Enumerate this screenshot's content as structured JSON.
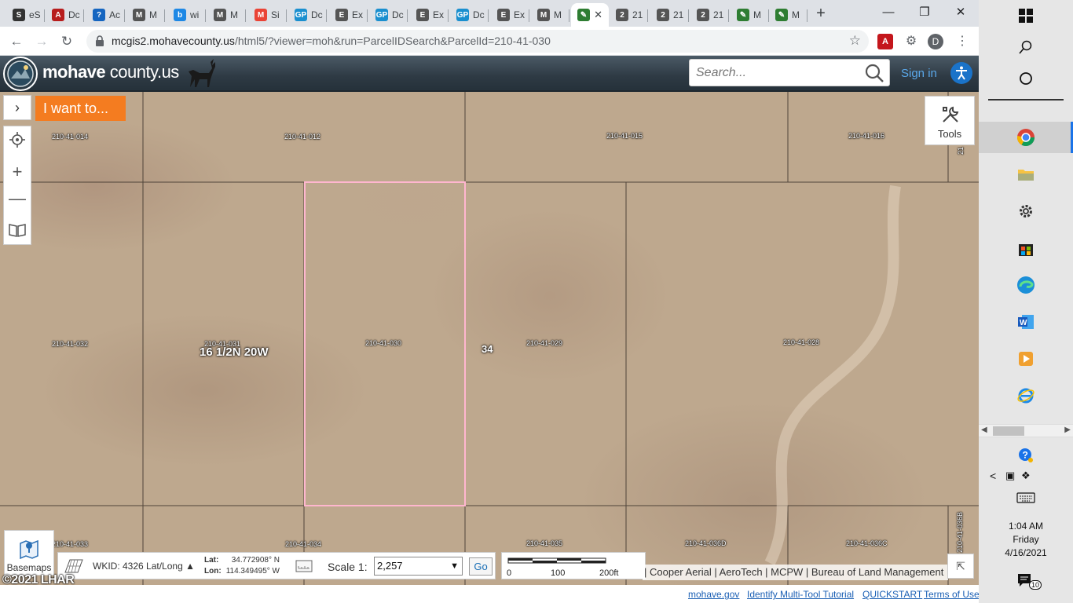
{
  "browser": {
    "tabs": [
      {
        "label": "eS",
        "fav_color": "#333333",
        "fav_glyph": "S"
      },
      {
        "label": "Dc",
        "fav_color": "#b71c1c",
        "fav_glyph": "A"
      },
      {
        "label": "Ac",
        "fav_color": "#1565c0",
        "fav_glyph": "?"
      },
      {
        "label": "M",
        "fav_color": "#555555",
        "fav_glyph": "M"
      },
      {
        "label": "wi",
        "fav_color": "#1e88e5",
        "fav_glyph": "b"
      },
      {
        "label": "M",
        "fav_color": "#555555",
        "fav_glyph": "M"
      },
      {
        "label": "Si",
        "fav_color": "#ea4335",
        "fav_glyph": "M"
      },
      {
        "label": "Dc",
        "fav_color": "#1a8fcf",
        "fav_glyph": "GP"
      },
      {
        "label": "Ex",
        "fav_color": "#555555",
        "fav_glyph": "E"
      },
      {
        "label": "Dc",
        "fav_color": "#1a8fcf",
        "fav_glyph": "GP"
      },
      {
        "label": "Ex",
        "fav_color": "#555555",
        "fav_glyph": "E"
      },
      {
        "label": "Dc",
        "fav_color": "#1a8fcf",
        "fav_glyph": "GP"
      },
      {
        "label": "Ex",
        "fav_color": "#555555",
        "fav_glyph": "E"
      },
      {
        "label": "M",
        "fav_color": "#555555",
        "fav_glyph": "M"
      },
      {
        "label": "",
        "fav_color": "#2e7d32",
        "fav_glyph": "✎",
        "active": true
      },
      {
        "label": "21",
        "fav_color": "#555555",
        "fav_glyph": "2"
      },
      {
        "label": "21",
        "fav_color": "#555555",
        "fav_glyph": "2"
      },
      {
        "label": "21",
        "fav_color": "#555555",
        "fav_glyph": "2"
      },
      {
        "label": "M",
        "fav_color": "#2e7d32",
        "fav_glyph": "✎"
      },
      {
        "label": "M",
        "fav_color": "#2e7d32",
        "fav_glyph": "✎"
      }
    ],
    "url_host": "mcgis2.mohavecounty.us",
    "url_path": "/html5/?viewer=moh&run=ParcelIDSearch&ParcelId=210-41-030",
    "profile_initial": "D"
  },
  "header": {
    "title_main": "mohave",
    "title_suffix": " county.us",
    "search_placeholder": "Search...",
    "signin_label": "Sign in"
  },
  "map": {
    "iwant_label": "I want to...",
    "tools_label": "Tools",
    "township_label": "16 1/2N 20W",
    "section_label": "34",
    "parcels": [
      {
        "id": "210-41-014"
      },
      {
        "id": "210-41-012"
      },
      {
        "id": "210-41-015"
      },
      {
        "id": "210-41-016"
      },
      {
        "id": "210-41-032"
      },
      {
        "id": "210-41-031"
      },
      {
        "id": "210-41-030"
      },
      {
        "id": "210-41-029"
      },
      {
        "id": "210-41-028"
      },
      {
        "id": "210-41-033"
      },
      {
        "id": "210-41-034"
      },
      {
        "id": "210-41-035"
      },
      {
        "id": "210-41-036D"
      },
      {
        "id": "210-41-036C"
      },
      {
        "id": "21"
      },
      {
        "id": "210-41-036B"
      }
    ]
  },
  "bottom": {
    "basemaps_label": "Basemaps",
    "wkid_label": "WKID: 4326 Lat/Long",
    "lat_label": "Lat:",
    "lat_value": "34.772908° N",
    "lon_label": "Lon:",
    "lon_value": "114.349495° W",
    "scale_label": "Scale 1:",
    "scale_value": "2,257",
    "go_label": "Go",
    "scalebar_ticks": [
      "0",
      "100",
      "200ft"
    ],
    "attribution": "| Cooper Aerial | AeroTech | MCPW | Bureau of Land Management",
    "copyright": "©2021 LHAR"
  },
  "footer": {
    "links": [
      "mohave.gov",
      "Identify Multi-Tool Tutorial",
      "QUICKSTART",
      "Terms of Use"
    ]
  },
  "taskbar": {
    "time": "1:04 AM",
    "day": "Friday",
    "date": "4/16/2021",
    "notif_count": "10"
  },
  "colors": {
    "accent_orange": "#f47c20",
    "link_blue": "#1a5fb4",
    "selected_parcel": "#ff9fc0"
  }
}
